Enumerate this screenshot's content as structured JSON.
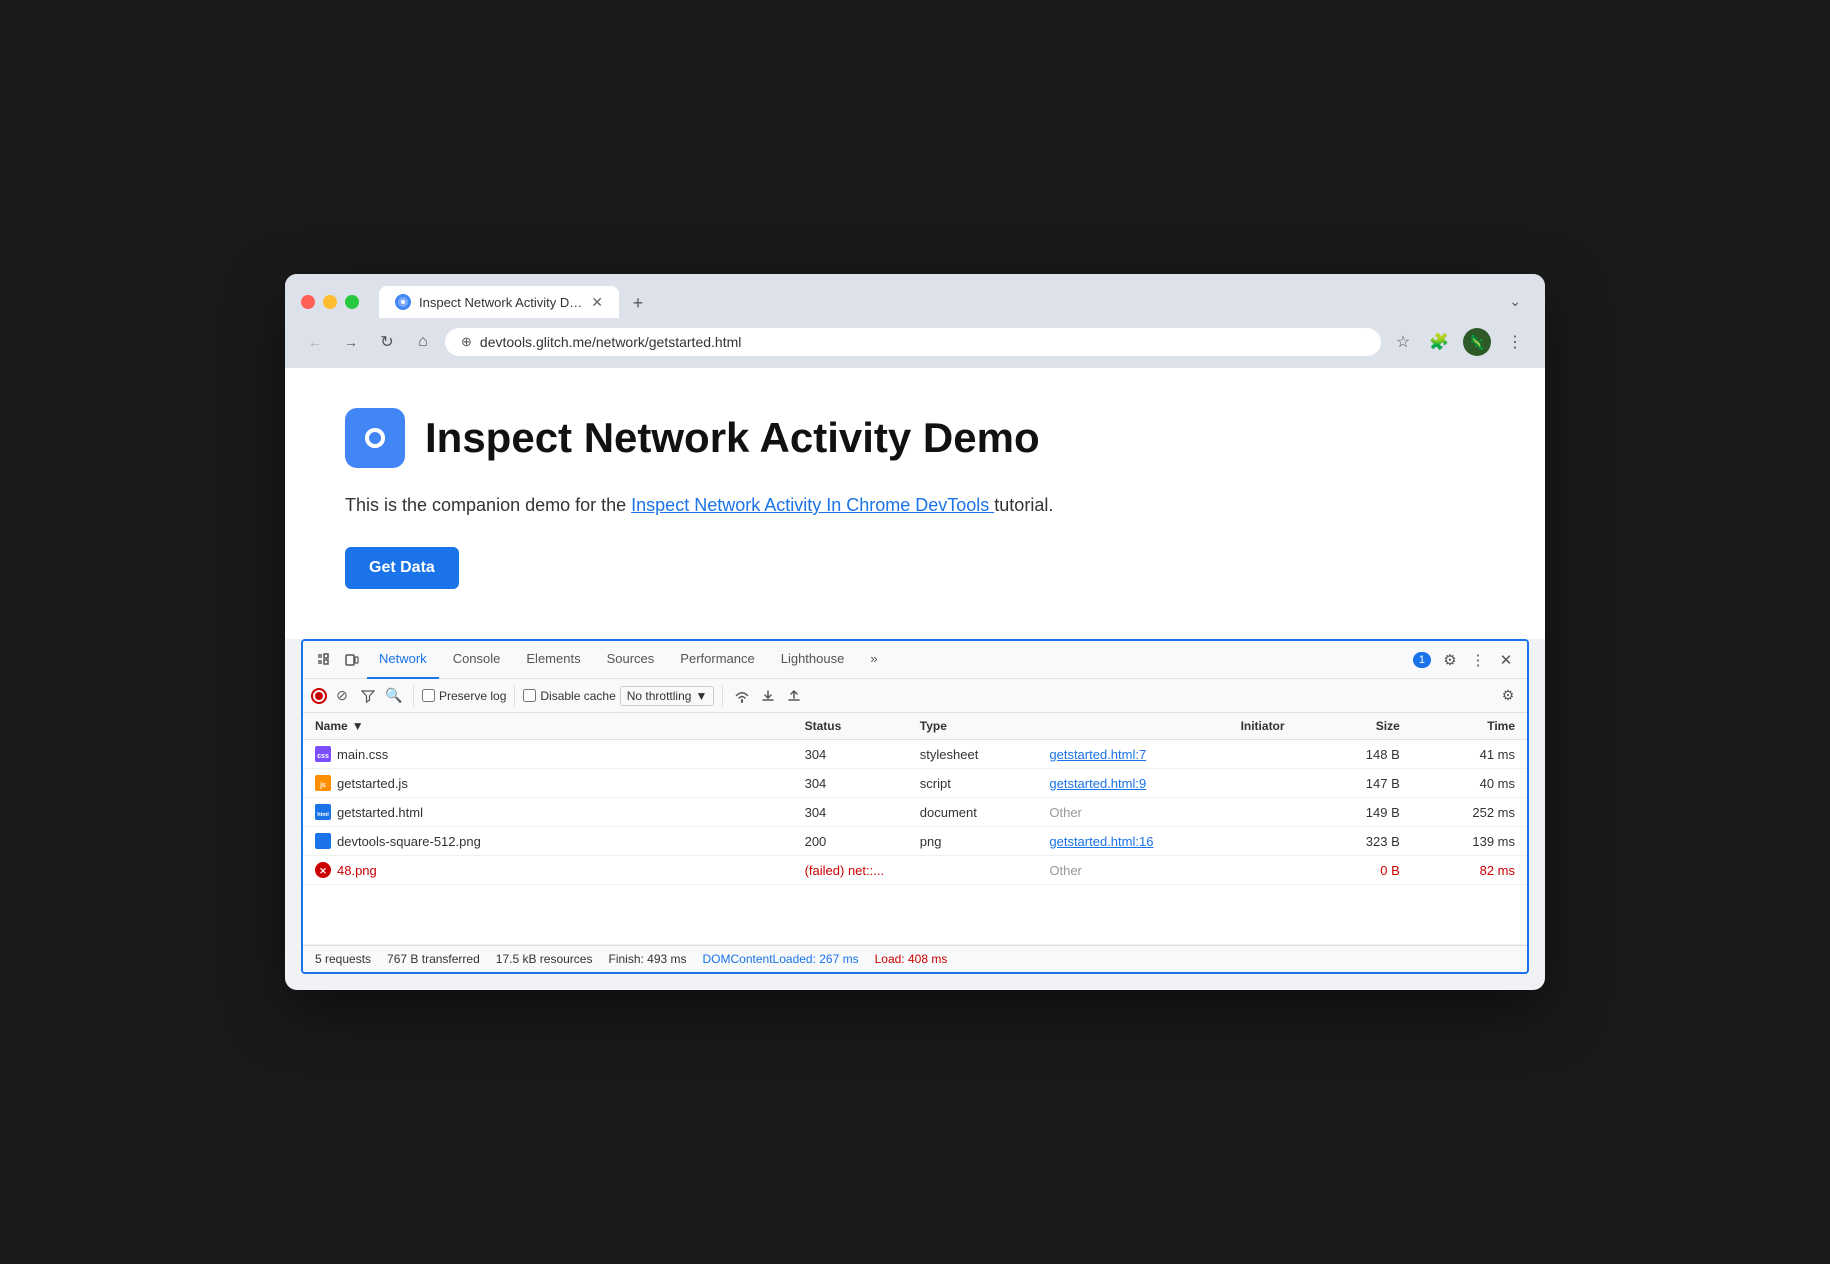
{
  "browser": {
    "tab_title": "Inspect Network Activity Dem",
    "tab_close": "✕",
    "tab_new": "+",
    "chevron": "⌄",
    "url": "devtools.glitch.me/network/getstarted.html"
  },
  "nav": {
    "back": "←",
    "forward": "→",
    "refresh": "↻",
    "home": "⌂",
    "star": "☆",
    "extension": "🧩",
    "menu": "⋮"
  },
  "page": {
    "title": "Inspect Network Activity Demo",
    "description_pre": "This is the companion demo for the ",
    "description_link": "Inspect Network Activity In Chrome DevTools ",
    "description_post": "tutorial.",
    "get_data_label": "Get Data"
  },
  "devtools": {
    "tabs": [
      "Network",
      "Console",
      "Elements",
      "Sources",
      "Performance",
      "Lighthouse",
      "»"
    ],
    "active_tab": "Network",
    "badge_count": "1",
    "toolbar_icons": [
      "selector",
      "device"
    ],
    "record_state": "recording",
    "clear_label": "⊘",
    "filter_label": "▽",
    "search_label": "🔍",
    "preserve_log": "Preserve log",
    "disable_cache": "Disable cache",
    "throttling": "No throttling",
    "settings_label": "⚙",
    "more_label": "⋮",
    "close_label": "✕"
  },
  "table": {
    "headers": [
      "Name",
      "Status",
      "Type",
      "Initiator",
      "Size",
      "Time"
    ],
    "rows": [
      {
        "icon_type": "css",
        "icon_label": "css",
        "name": "main.css",
        "status": "304",
        "type": "stylesheet",
        "initiator": "getstarted.html:7",
        "initiator_link": true,
        "size": "148 B",
        "time": "41 ms",
        "failed": false
      },
      {
        "icon_type": "js",
        "icon_label": "js",
        "name": "getstarted.js",
        "status": "304",
        "type": "script",
        "initiator": "getstarted.html:9",
        "initiator_link": true,
        "size": "147 B",
        "time": "40 ms",
        "failed": false
      },
      {
        "icon_type": "html",
        "icon_label": "html",
        "name": "getstarted.html",
        "status": "304",
        "type": "document",
        "initiator": "Other",
        "initiator_link": false,
        "size": "149 B",
        "time": "252 ms",
        "failed": false
      },
      {
        "icon_type": "png",
        "icon_label": "png",
        "name": "devtools-square-512.png",
        "status": "200",
        "type": "png",
        "initiator": "getstarted.html:16",
        "initiator_link": true,
        "size": "323 B",
        "time": "139 ms",
        "failed": false
      },
      {
        "icon_type": "err",
        "icon_label": "✕",
        "name": "48.png",
        "status": "(failed)  net::...",
        "type": "",
        "initiator": "Other",
        "initiator_link": false,
        "size": "0 B",
        "time": "82 ms",
        "failed": true
      }
    ]
  },
  "status_bar": {
    "requests": "5 requests",
    "transferred": "767 B transferred",
    "resources": "17.5 kB resources",
    "finish": "Finish: 493 ms",
    "dom_loaded": "DOMContentLoaded: 267 ms",
    "load": "Load: 408 ms"
  }
}
